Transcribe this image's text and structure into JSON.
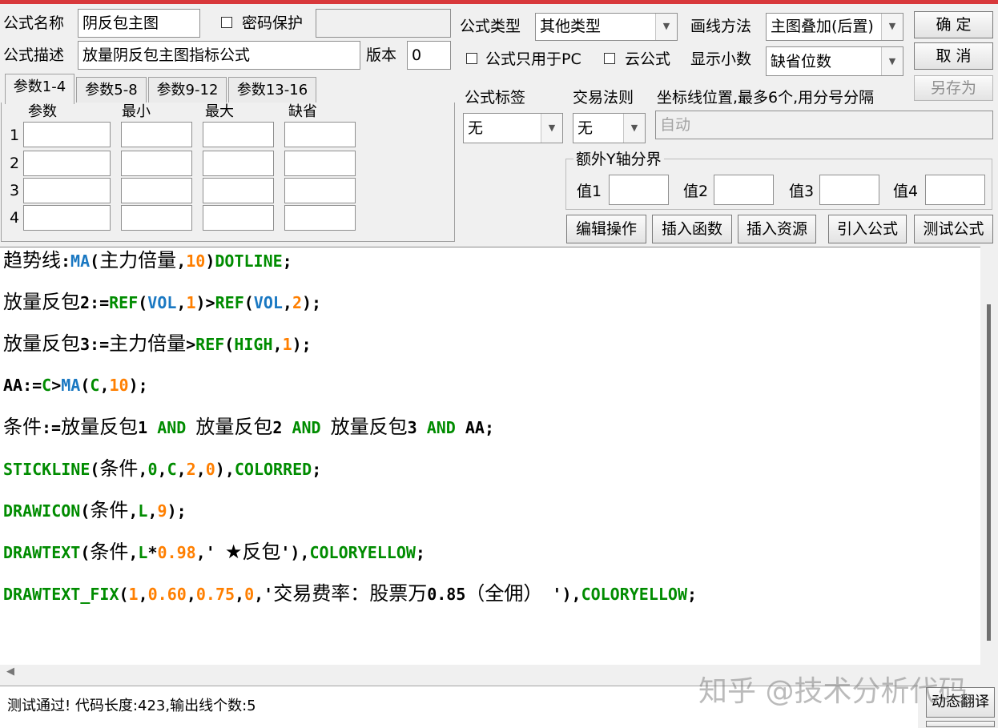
{
  "form": {
    "name_label": "公式名称",
    "name_value": "阴反包主图",
    "password_label": "密码保护",
    "desc_label": "公式描述",
    "desc_value": "放量阴反包主图指标公式",
    "version_label": "版本",
    "version_value": "0",
    "type_label": "公式类型",
    "type_value": "其他类型",
    "draw_method_label": "画线方法",
    "draw_method_value": "主图叠加(后置)",
    "pc_only_label": "公式只用于PC",
    "cloud_label": "云公式",
    "decimal_label": "显示小数",
    "decimal_value": "缺省位数",
    "tag_label": "公式标签",
    "tag_value": "无",
    "trade_rule_label": "交易法则",
    "trade_rule_value": "无",
    "coord_label": "坐标线位置,最多6个,用分号分隔",
    "coord_value": "自动",
    "y_axis_group_label": "额外Y轴分界",
    "y_values": [
      "值1",
      "值2",
      "值3",
      "值4"
    ]
  },
  "buttons": {
    "ok": "确  定",
    "cancel": "取  消",
    "save_as": "另存为",
    "edit_op": "编辑操作",
    "insert_func": "插入函数",
    "insert_res": "插入资源",
    "import_formula": "引入公式",
    "test_formula": "测试公式",
    "dynamic_translate": "动态翻译"
  },
  "tabs": [
    "参数1-4",
    "参数5-8",
    "参数9-12",
    "参数13-16"
  ],
  "params": {
    "headers": [
      "参数",
      "最小",
      "最大",
      "缺省"
    ],
    "rows": [
      "1",
      "2",
      "3",
      "4"
    ]
  },
  "colors": {
    "keyword": "#008c00",
    "function_blue": "#1a78c2",
    "number": "#ff7f00",
    "title_bar": "#d8383b"
  },
  "code": [
    [
      {
        "t": "趋势线",
        "c": "cn"
      },
      {
        "t": ":"
      },
      {
        "t": "MA",
        "c": "blue"
      },
      {
        "t": "("
      },
      {
        "t": "主力倍量",
        "c": "cn"
      },
      {
        "t": ","
      },
      {
        "t": "10",
        "c": "num"
      },
      {
        "t": ")"
      },
      {
        "t": "DOTLINE",
        "c": "kw"
      },
      {
        "t": ";"
      }
    ],
    [
      {
        "t": "放量反包",
        "c": "cn"
      },
      {
        "t": "2:="
      },
      {
        "t": "REF",
        "c": "kw"
      },
      {
        "t": "("
      },
      {
        "t": "VOL",
        "c": "blue"
      },
      {
        "t": ","
      },
      {
        "t": "1",
        "c": "num"
      },
      {
        "t": ")>"
      },
      {
        "t": "REF",
        "c": "kw"
      },
      {
        "t": "("
      },
      {
        "t": "VOL",
        "c": "blue"
      },
      {
        "t": ","
      },
      {
        "t": "2",
        "c": "num"
      },
      {
        "t": ");"
      }
    ],
    [
      {
        "t": "放量反包",
        "c": "cn"
      },
      {
        "t": "3:="
      },
      {
        "t": "主力倍量",
        "c": "cn"
      },
      {
        "t": ">"
      },
      {
        "t": "REF",
        "c": "kw"
      },
      {
        "t": "("
      },
      {
        "t": "HIGH",
        "c": "kw"
      },
      {
        "t": ","
      },
      {
        "t": "1",
        "c": "num"
      },
      {
        "t": ");"
      }
    ],
    [
      {
        "t": "AA:="
      },
      {
        "t": "C",
        "c": "kw"
      },
      {
        "t": ">"
      },
      {
        "t": "MA",
        "c": "blue"
      },
      {
        "t": "("
      },
      {
        "t": "C",
        "c": "kw"
      },
      {
        "t": ","
      },
      {
        "t": "10",
        "c": "num"
      },
      {
        "t": ");"
      }
    ],
    [
      {
        "t": "条件",
        "c": "cn"
      },
      {
        "t": ":="
      },
      {
        "t": "放量反包",
        "c": "cn"
      },
      {
        "t": "1 "
      },
      {
        "t": "AND",
        "c": "kw"
      },
      {
        "t": " "
      },
      {
        "t": "放量反包",
        "c": "cn"
      },
      {
        "t": "2 "
      },
      {
        "t": "AND",
        "c": "kw"
      },
      {
        "t": " "
      },
      {
        "t": "放量反包",
        "c": "cn"
      },
      {
        "t": "3 "
      },
      {
        "t": "AND",
        "c": "kw"
      },
      {
        "t": " AA;"
      }
    ],
    [
      {
        "t": "STICKLINE",
        "c": "kw"
      },
      {
        "t": "("
      },
      {
        "t": "条件",
        "c": "cn"
      },
      {
        "t": ","
      },
      {
        "t": "0",
        "c": "kw"
      },
      {
        "t": ","
      },
      {
        "t": "C",
        "c": "kw"
      },
      {
        "t": ","
      },
      {
        "t": "2",
        "c": "num"
      },
      {
        "t": ","
      },
      {
        "t": "0",
        "c": "num"
      },
      {
        "t": "),"
      },
      {
        "t": "COLORRED",
        "c": "kw"
      },
      {
        "t": ";"
      }
    ],
    [
      {
        "t": "DRAWICON",
        "c": "kw"
      },
      {
        "t": "("
      },
      {
        "t": "条件",
        "c": "cn"
      },
      {
        "t": ","
      },
      {
        "t": "L",
        "c": "kw"
      },
      {
        "t": ","
      },
      {
        "t": "9",
        "c": "num"
      },
      {
        "t": ");"
      }
    ],
    [
      {
        "t": "DRAWTEXT",
        "c": "kw"
      },
      {
        "t": "("
      },
      {
        "t": "条件",
        "c": "cn"
      },
      {
        "t": ","
      },
      {
        "t": "L",
        "c": "kw"
      },
      {
        "t": "*"
      },
      {
        "t": "0.98",
        "c": "num"
      },
      {
        "t": ",' "
      },
      {
        "t": "★反包",
        "c": "cn"
      },
      {
        "t": "'),"
      },
      {
        "t": "COLORYELLOW",
        "c": "kw"
      },
      {
        "t": ";"
      }
    ],
    [
      {
        "t": "DRAWTEXT_FIX",
        "c": "kw"
      },
      {
        "t": "("
      },
      {
        "t": "1",
        "c": "num"
      },
      {
        "t": ","
      },
      {
        "t": "0.60",
        "c": "num"
      },
      {
        "t": ","
      },
      {
        "t": "0.75",
        "c": "num"
      },
      {
        "t": ","
      },
      {
        "t": "0",
        "c": "num"
      },
      {
        "t": ",'"
      },
      {
        "t": "交易费率：股票万",
        "c": "cn"
      },
      {
        "t": "0.85"
      },
      {
        "t": "（全佣）",
        "c": "cn"
      },
      {
        "t": " '),"
      },
      {
        "t": "COLORYELLOW",
        "c": "kw"
      },
      {
        "t": ";"
      }
    ]
  ],
  "status": "测试通过! 代码长度:423,输出线个数:5",
  "watermark": "知乎 @技术分析代码"
}
